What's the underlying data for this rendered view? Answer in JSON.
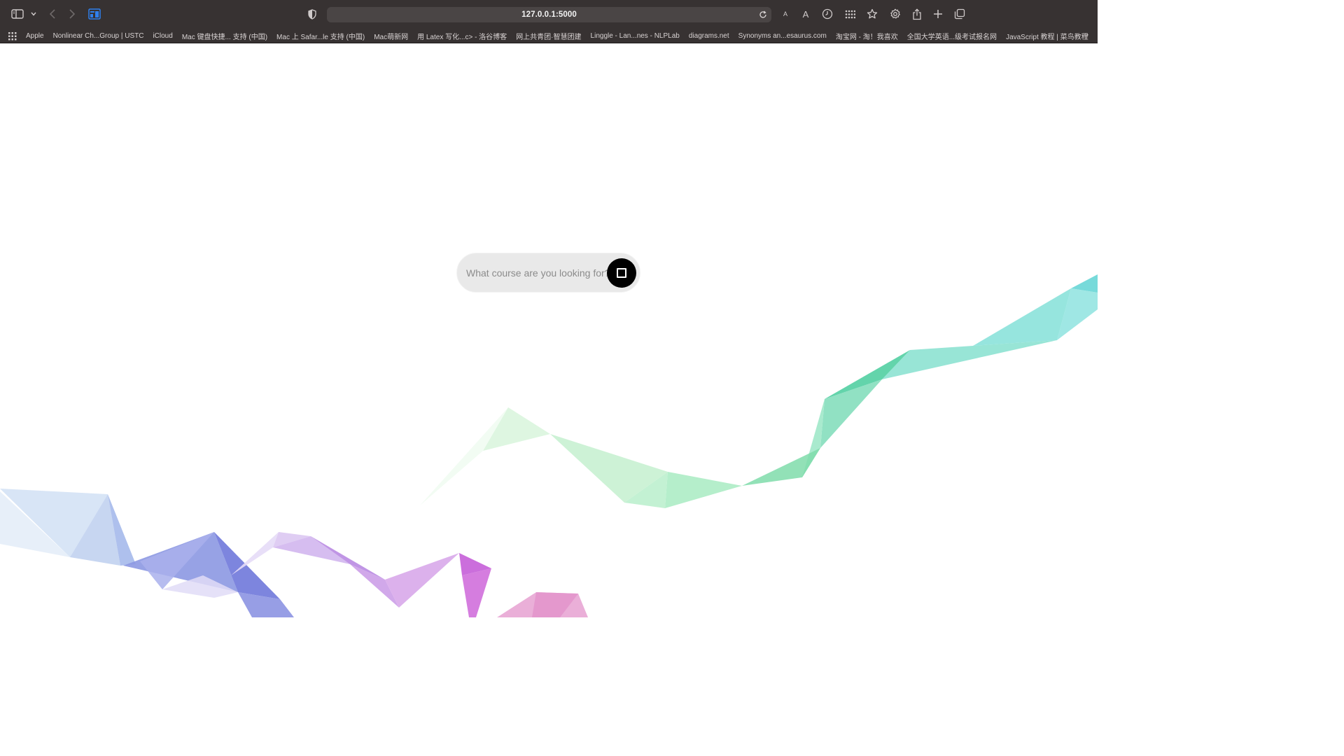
{
  "browser": {
    "url": "127.0.0.1:5000",
    "icons": {
      "sidebar": "sidebar-toggle-icon",
      "sidebar_menu": "chevron-down-icon",
      "back": "chevron-left-icon",
      "forward": "chevron-right-icon",
      "tab_app": "tab-app-icon",
      "privacy": "shield-icon",
      "reload": "reload-icon",
      "text_smaller": "text-smaller-icon",
      "text_larger": "text-larger-icon",
      "history": "clock-icon",
      "extensions": "grid-icon",
      "bookmark": "star-icon",
      "settings": "gear-icon",
      "share": "share-icon",
      "new_tab": "plus-icon",
      "tab_overview": "tabs-overview-icon"
    },
    "text_smaller_label": "A",
    "text_larger_label": "A",
    "bookmarks": [
      "Apple",
      "Nonlinear Ch...Group | USTC",
      "iCloud",
      "Mac 键盘快捷... 支持 (中国)",
      "Mac 上 Safar...le 支持 (中国)",
      "Mac萌新网",
      "用 Latex 写化...c> - 洛谷博客",
      "网上共青团·智慧团建",
      "Linggle - Lan...nes - NLPLab",
      "diagrams.net",
      "Synonyms an...esaurus.com",
      "淘宝网 - 淘！我喜欢",
      "全国大学英语...级考试报名网",
      "JavaScript 教程 | 菜鸟教程"
    ],
    "bookmarks_more": "»"
  },
  "search": {
    "placeholder": "What course are you looking for?",
    "value": ""
  },
  "colors": {
    "toolbar_bg": "#373232",
    "page_bg": "#ffffff",
    "search_bg": "#e9e9e9",
    "button_bg": "#000000"
  }
}
